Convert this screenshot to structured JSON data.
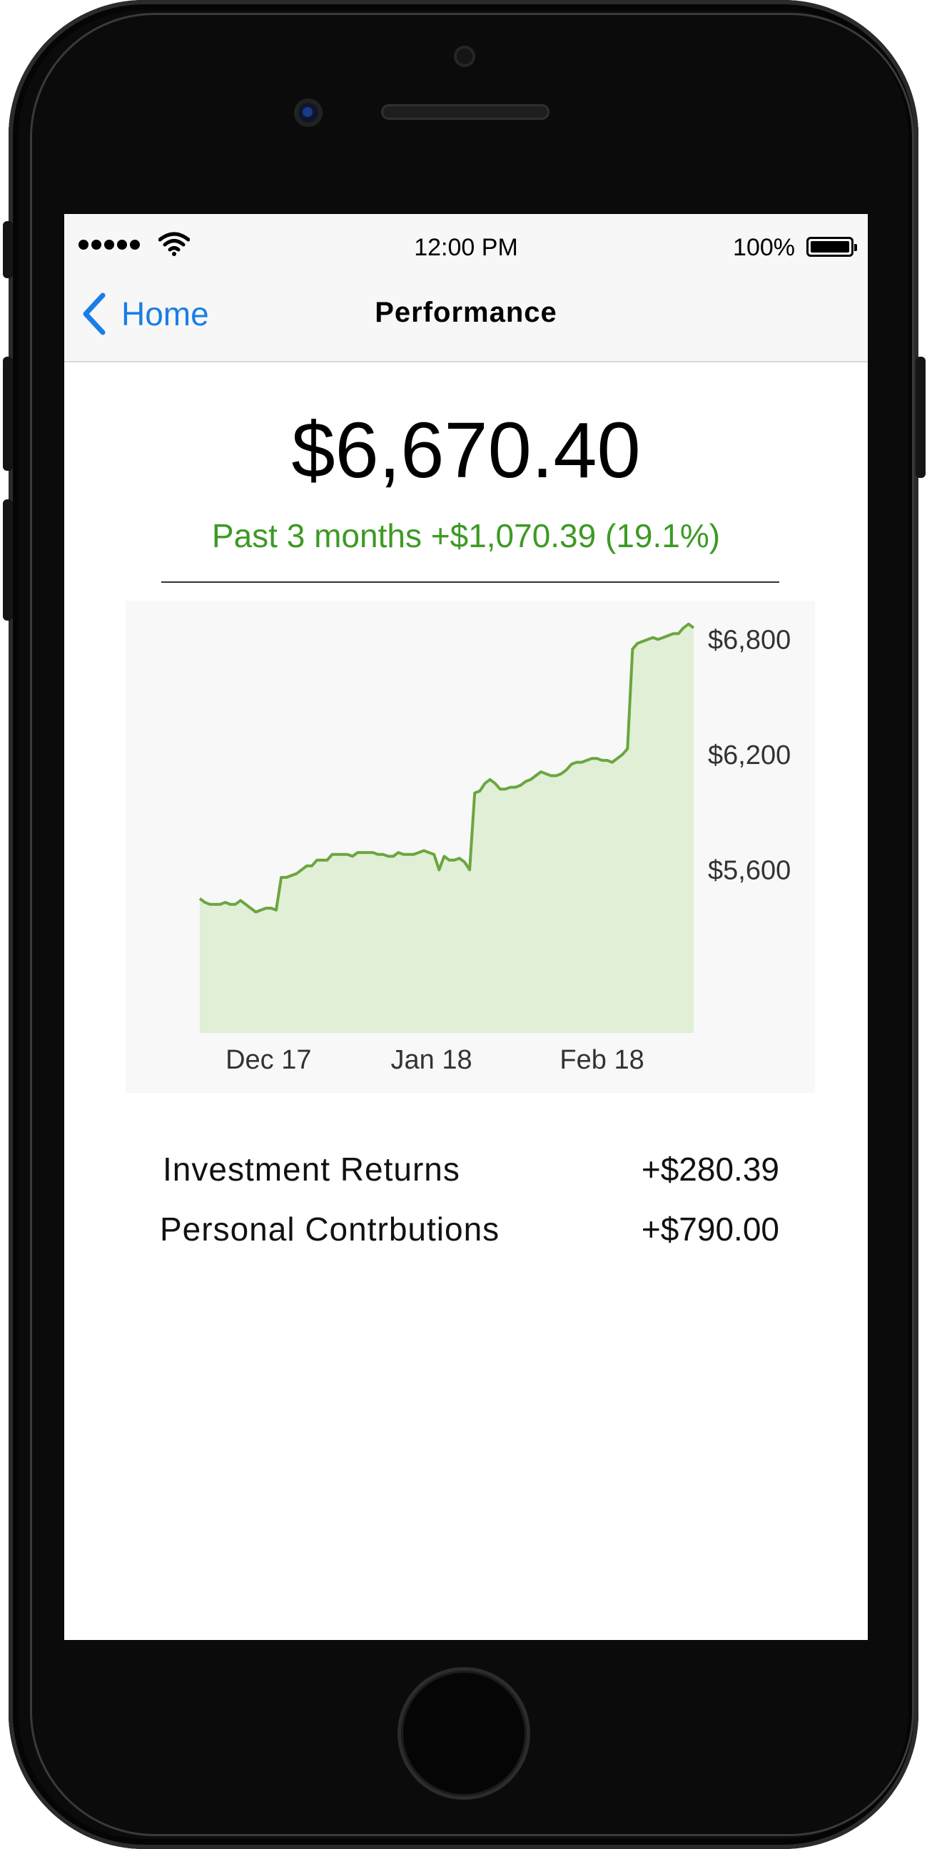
{
  "statusbar": {
    "time": "12:00 PM",
    "battery": "100%"
  },
  "nav": {
    "back_label": "Home",
    "title": "Performance"
  },
  "summary": {
    "total": "$6,670.40",
    "change": "Past 3 months +$1,070.39 (19.1%)"
  },
  "colors": {
    "accent": "#1a7ee6",
    "positive": "#3d9a24",
    "line": "#6aa63e",
    "fill": "#e0efd6"
  },
  "breakdown": [
    {
      "label": "Investment Returns",
      "value": "+$280.39"
    },
    {
      "label": "Personal Contrbutions",
      "value": "+$790.00"
    }
  ],
  "chart_data": {
    "type": "area",
    "x_labels": [
      "Dec 17",
      "Jan 18",
      "Feb 18"
    ],
    "y_ticks": [
      "$6,800",
      "$6,200",
      "$5,600"
    ],
    "y_tick_values": [
      6800,
      6200,
      5600
    ],
    "ylim": [
      4750,
      6950
    ],
    "xlim": [
      0,
      97
    ],
    "x_tick_positions": [
      13.5,
      45.5,
      79
    ],
    "series": [
      {
        "values": [
          5450,
          5430,
          5420,
          5420,
          5420,
          5430,
          5420,
          5420,
          5440,
          5420,
          5400,
          5380,
          5390,
          5400,
          5400,
          5390,
          5560,
          5560,
          5570,
          5580,
          5600,
          5620,
          5620,
          5650,
          5650,
          5650,
          5680,
          5680,
          5680,
          5680,
          5670,
          5690,
          5690,
          5690,
          5690,
          5680,
          5680,
          5670,
          5670,
          5690,
          5680,
          5680,
          5680,
          5690,
          5700,
          5690,
          5680,
          5600,
          5670,
          5650,
          5650,
          5660,
          5640,
          5600,
          6000,
          6010,
          6050,
          6070,
          6050,
          6020,
          6020,
          6030,
          6030,
          6040,
          6060,
          6070,
          6090,
          6110,
          6100,
          6090,
          6090,
          6100,
          6120,
          6150,
          6160,
          6160,
          6170,
          6180,
          6180,
          6170,
          6170,
          6160,
          6180,
          6200,
          6230,
          6750,
          6780,
          6790,
          6800,
          6810,
          6800,
          6810,
          6820,
          6830,
          6830,
          6860,
          6880,
          6860
        ]
      }
    ]
  }
}
